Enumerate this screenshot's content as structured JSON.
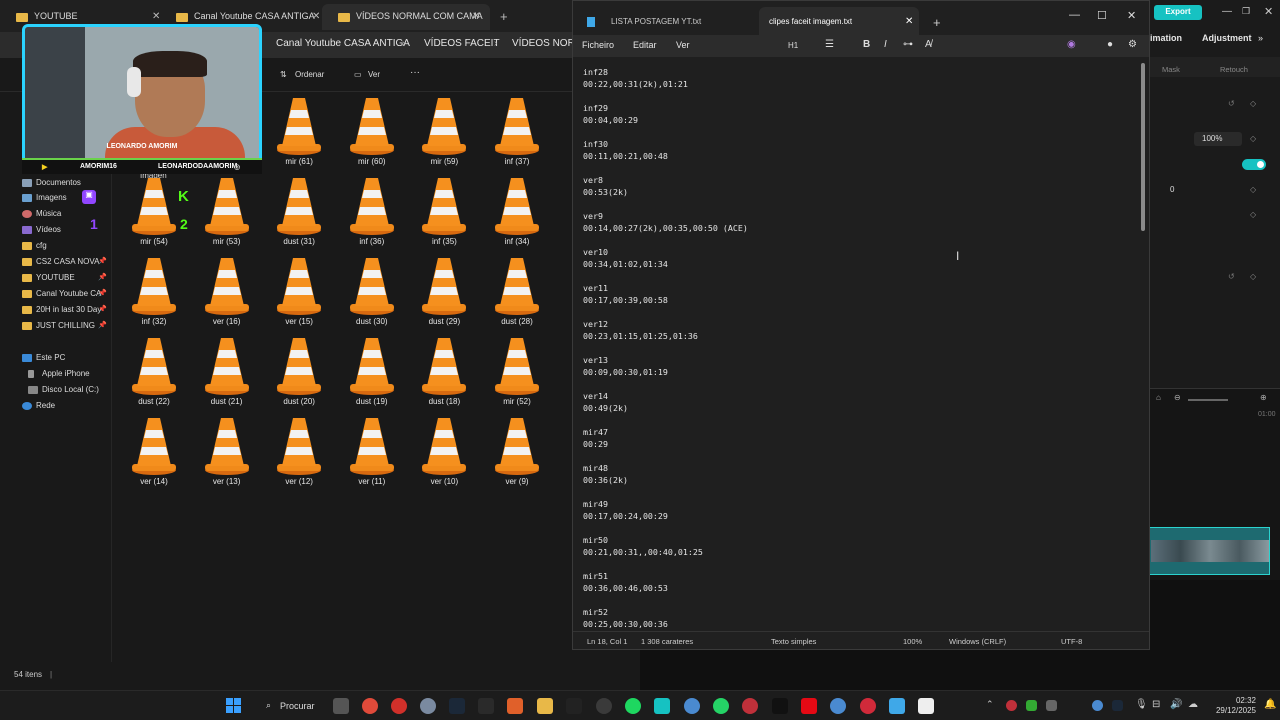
{
  "explorer": {
    "tabs": [
      {
        "label": "YOUTUBE"
      },
      {
        "label": "Canal Youtube CASA ANTIGA"
      },
      {
        "label": "VÍDEOS NORMAL COM CAMA"
      }
    ],
    "breadcrumbs": [
      "Canal Youtube CASA ANTIGA",
      "VÍDEOS FACEIT",
      "VÍDEOS NORM"
    ],
    "toolbar": {
      "sort_label": "Ordenar",
      "view_label": "Ver",
      "more_label": "···"
    },
    "nav": {
      "quick": [
        {
          "label": "Documentos"
        },
        {
          "label": "Imagens"
        },
        {
          "label": "Música"
        },
        {
          "label": "Vídeos"
        },
        {
          "label": "cfg"
        },
        {
          "label": "CS2 CASA NOVA"
        },
        {
          "label": "YOUTUBE"
        },
        {
          "label": "Canal Youtube CA"
        },
        {
          "label": "20H in last 30 Day"
        },
        {
          "label": "JUST CHILLING"
        }
      ],
      "pc": [
        {
          "label": "Este PC"
        },
        {
          "label": "Apple iPhone"
        },
        {
          "label": "Disco Local (C:)"
        },
        {
          "label": "Rede"
        }
      ]
    },
    "partial_label": "Imagen",
    "files": [
      "mir (61)",
      "mir (60)",
      "mir (59)",
      "inf (37)",
      "mir (54)",
      "mir (53)",
      "dust (31)",
      "inf (36)",
      "inf (35)",
      "inf (34)",
      "inf (32)",
      "ver (16)",
      "ver (15)",
      "dust (30)",
      "dust (29)",
      "dust (28)",
      "dust (22)",
      "dust (21)",
      "dust (20)",
      "dust (19)",
      "dust (18)",
      "mir (52)",
      "ver (14)",
      "ver (13)",
      "ver (12)",
      "ver (11)",
      "ver (10)",
      "ver (9)"
    ],
    "status": "54 itens"
  },
  "webcam": {
    "name": "LEONARDO AMORIM",
    "socials": [
      "AMORIM16",
      "LEONARDODAAMORIM"
    ],
    "badges": [
      "K",
      "1",
      "2"
    ]
  },
  "notepad": {
    "tabs": [
      "LISTA POSTAGEM YT.txt",
      "clipes faceit imagem.txt"
    ],
    "menu": [
      "Ficheiro",
      "Editar",
      "Ver"
    ],
    "format": {
      "heading": "H1"
    },
    "lines": [
      {
        "name": "inf28",
        "times": "00:22,00:31(2k),01:21"
      },
      {
        "name": "inf29",
        "times": "00:04,00:29"
      },
      {
        "name": "inf30",
        "times": "00:11,00:21,00:48"
      },
      {
        "name": "ver8",
        "times": "00:53(2k)"
      },
      {
        "name": "ver9",
        "times": "00:14,00:27(2k),00:35,00:50 (ACE)"
      },
      {
        "name": "ver10",
        "times": "00:34,01:02,01:34"
      },
      {
        "name": "ver11",
        "times": "00:17,00:39,00:58"
      },
      {
        "name": "ver12",
        "times": "00:23,01:15,01:25,01:36"
      },
      {
        "name": "ver13",
        "times": "00:09,00:30,01:19"
      },
      {
        "name": "ver14",
        "times": "00:49(2k)"
      },
      {
        "name": "mir47",
        "times": "00:29"
      },
      {
        "name": "mir48",
        "times": "00:36(2k)"
      },
      {
        "name": "mir49",
        "times": "00:17,00:24,00:29"
      },
      {
        "name": "mir50",
        "times": "00:21,00:31,,00:40,01:25"
      },
      {
        "name": "mir51",
        "times": "00:36,00:46,00:53"
      },
      {
        "name": "mir52",
        "times": "00:25,00:30,00:36"
      }
    ],
    "status": {
      "position": "Ln 18, Col 1",
      "chars": "1 308 carateres",
      "format": "Texto simples",
      "zoom": "100%",
      "eol": "Windows (CRLF)",
      "encoding": "UTF-8"
    }
  },
  "editor_app": {
    "export_label": "Export",
    "tabs": [
      "imation",
      "Adjustment"
    ],
    "subtabs": [
      "Mask",
      "Retouch"
    ],
    "percent": "100%",
    "value_zero": "0",
    "time_marker": "01:00",
    "accent_color": "#16c2c2"
  },
  "taskbar": {
    "search_label": "Procurar",
    "time": "02:32",
    "date": "29/12/2025"
  }
}
